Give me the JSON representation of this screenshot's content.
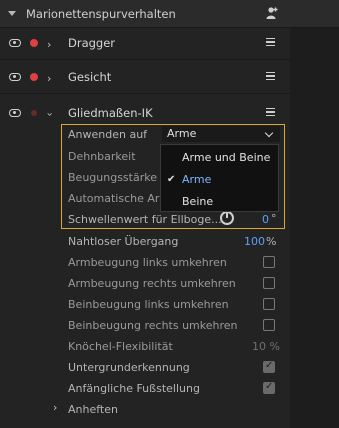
{
  "panel": {
    "title": "Marionettenspurverhalten",
    "header_icon": "person-add-icon"
  },
  "layers": [
    {
      "name": "Dragger"
    },
    {
      "name": "Gesicht"
    },
    {
      "name": "Gliedmaßen-IK"
    }
  ],
  "ik": {
    "anwenden_label": "Anwenden auf",
    "anwenden_value": "Arme",
    "dehnbarkeit_label": "Dehnbarkeit",
    "beugung_label": "Beugungsstärke",
    "auto_arm_label": "Automatische Arm",
    "schwellen_label": "Schwellenwert für Ellboge...",
    "schwellen_value": "0",
    "schwellen_unit": "°",
    "dropdown_options": [
      "Arme und Beine",
      "Arme",
      "Beine"
    ],
    "dropdown_selected": "Arme",
    "nahtlos_label": "Nahtloser Übergang",
    "nahtlos_value": "100",
    "nahtlos_unit": "%",
    "checks": [
      {
        "label": "Armbeugung links umkehren",
        "checked": false
      },
      {
        "label": "Armbeugung rechts umkehren",
        "checked": false
      },
      {
        "label": "Beinbeugung links umkehren",
        "checked": false
      },
      {
        "label": "Beinbeugung rechts umkehren",
        "checked": false
      }
    ],
    "knoechel_label": "Knöchel-Flexibilität",
    "knoechel_value": "10 %",
    "untergrund_label": "Untergrunderkennung",
    "untergrund_checked": true,
    "fussstellung_label": "Anfängliche Fußstellung",
    "fussstellung_checked": true,
    "anheften_label": "Anheften"
  },
  "colors": {
    "accent_outline": "#d9a92c",
    "value_blue": "#5aa0ff",
    "dot_red": "#e04040"
  }
}
